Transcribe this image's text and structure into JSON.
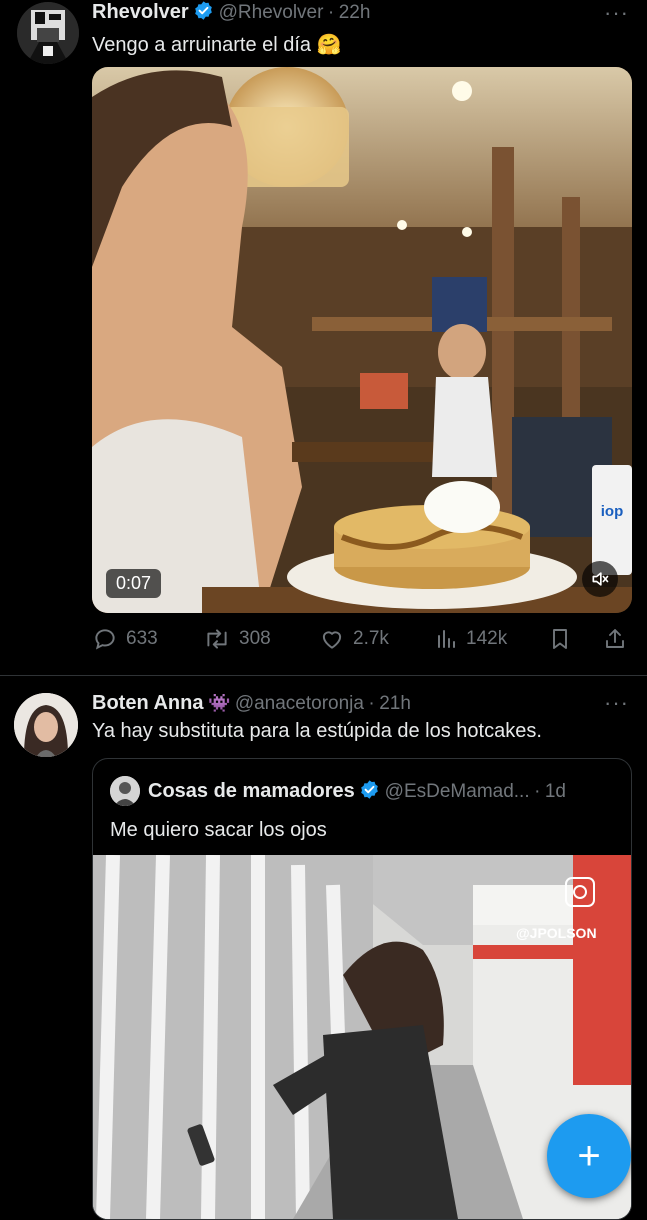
{
  "colors": {
    "background": "#000000",
    "text": "#e7e9ea",
    "muted": "#71767b",
    "accent": "#1d9bf0",
    "divider": "#2f3336"
  },
  "tweet1": {
    "display_name": "Rhevolver",
    "handle": "@Rhevolver",
    "separator": "·",
    "time": "22h",
    "more": "···",
    "text": "Vengo a arruinarte el día 🤗",
    "video": {
      "duration": "0:07",
      "cup_logo": "iop"
    },
    "actions": {
      "replies": "633",
      "retweets": "308",
      "likes": "2.7k",
      "views": "142k"
    }
  },
  "tweet2": {
    "display_name": "Boten Anna",
    "name_emoji": "👾",
    "handle": "@anacetoronja",
    "separator": "·",
    "time": "21h",
    "more": "···",
    "text": "Ya hay substituta para la estúpida de los hotcakes.",
    "quote": {
      "display_name": "Cosas de mamadores",
      "handle": "@EsDeMamad...",
      "separator": "·",
      "time": "1d",
      "text": "Me quiero sacar los ojos",
      "watermark": "@JPOLSON"
    }
  },
  "fab": {
    "label": "+"
  }
}
